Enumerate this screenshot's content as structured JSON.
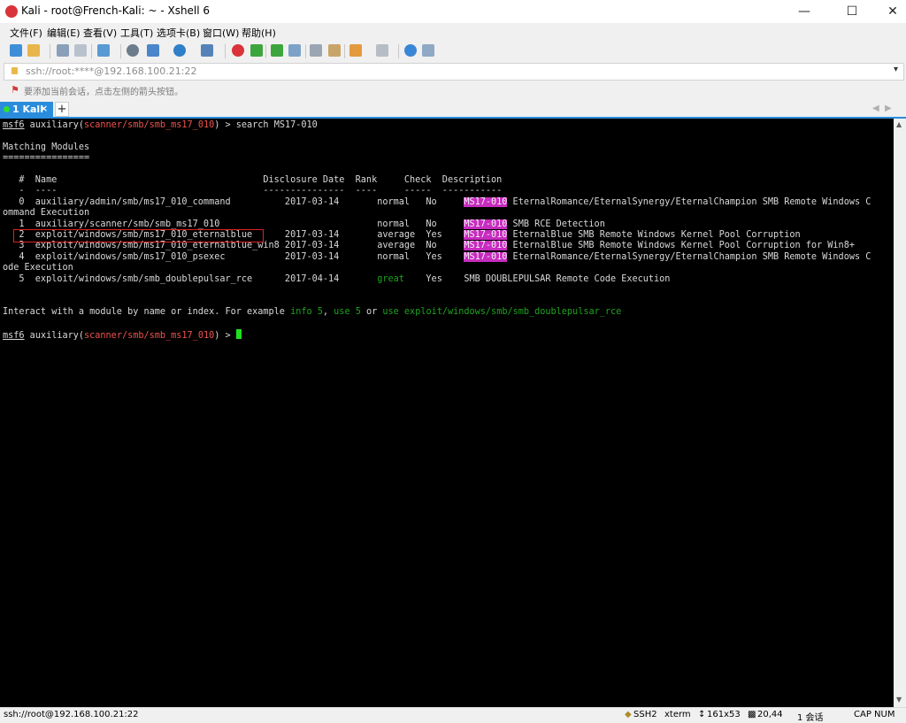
{
  "window": {
    "title": "Kali - root@French-Kali: ~ - Xshell 6",
    "minimize": "—",
    "maximize": "☐",
    "close": "✕"
  },
  "menu": [
    "文件(F)",
    "编辑(E)",
    "查看(V)",
    "工具(T)",
    "选项卡(B)",
    "窗口(W)",
    "帮助(H)"
  ],
  "address": {
    "value": "ssh://root:****@192.168.100.21:22",
    "dropdown": "▾"
  },
  "hint": {
    "icon": "bookmark-icon",
    "text": "要添加当前会话，点击左侧的箭头按钮。"
  },
  "tabs": {
    "active_label": "1 Kali",
    "close": "×",
    "add": "+",
    "prev": "◀",
    "next": "▶"
  },
  "terminal": {
    "prompt_msf": "msf6",
    "prompt_auxiliary": " auxiliary(",
    "prompt_module": "scanner/smb/smb_ms17_010",
    "prompt_close": ") > ",
    "command1": "search MS17-010",
    "matching_header": "Matching Modules",
    "underline": "================",
    "col_header": "   #  Name                                      Disclosure Date  Rank     Check  Description",
    "col_dashes": "   -  ----                                      ---------------  ----     -----  -----------",
    "highlight": "MS17-010",
    "rows": [
      {
        "pre": "   0  auxiliary/admin/smb/ms17_010_command          2017-03-14       normal   No     ",
        "desc": " EternalRomance/EternalSynergy/EternalChampion SMB Remote Windows C"
      },
      {
        "pre": "ommand Execution"
      },
      {
        "pre": "   1  auxiliary/scanner/smb/smb_ms17_010                             normal   No     ",
        "desc": " SMB RCE Detection"
      },
      {
        "pre": "   2  exploit/windows/smb/ms17_010_eternalblue      2017-03-14       average  Yes    ",
        "desc": " EternalBlue SMB Remote Windows Kernel Pool Corruption"
      },
      {
        "pre": "   3  exploit/windows/smb/ms17_010_eternalblue_win8 2017-03-14       average  No     ",
        "desc": " EternalBlue SMB Remote Windows Kernel Pool Corruption for Win8+"
      },
      {
        "pre": "   4  exploit/windows/smb/ms17_010_psexec           2017-03-14       normal   Yes    ",
        "desc": " EternalRomance/EternalSynergy/EternalChampion SMB Remote Windows C"
      },
      {
        "pre": "ode Execution"
      },
      {
        "pre": "   5  exploit/windows/smb/smb_doublepulsar_rce      2017-04-14       ",
        "rank_great": "great",
        "post": "    Yes    SMB DOUBLEPULSAR Remote Code Execution"
      }
    ],
    "interact_pre": "Interact with a module by name or index. For example ",
    "interact_g1": "info 5",
    "interact_sep1": ", ",
    "interact_g2": "use 5",
    "interact_sep2": " or ",
    "interact_g3": "use exploit/windows/smb/smb_doublepulsar_rce"
  },
  "status": {
    "connection": "ssh://root@192.168.100.21:22",
    "protocol": "SSH2",
    "terminal_type": "xterm",
    "size": "161x53",
    "cursor_pos": "20,44",
    "sessions": "1 会话",
    "caps": "CAP NUM"
  },
  "colors": {
    "accent": "#2a8cdc",
    "prompt_red": "#f0524d",
    "highlight_magenta": "#c72bbf",
    "green": "#1ea41e"
  }
}
